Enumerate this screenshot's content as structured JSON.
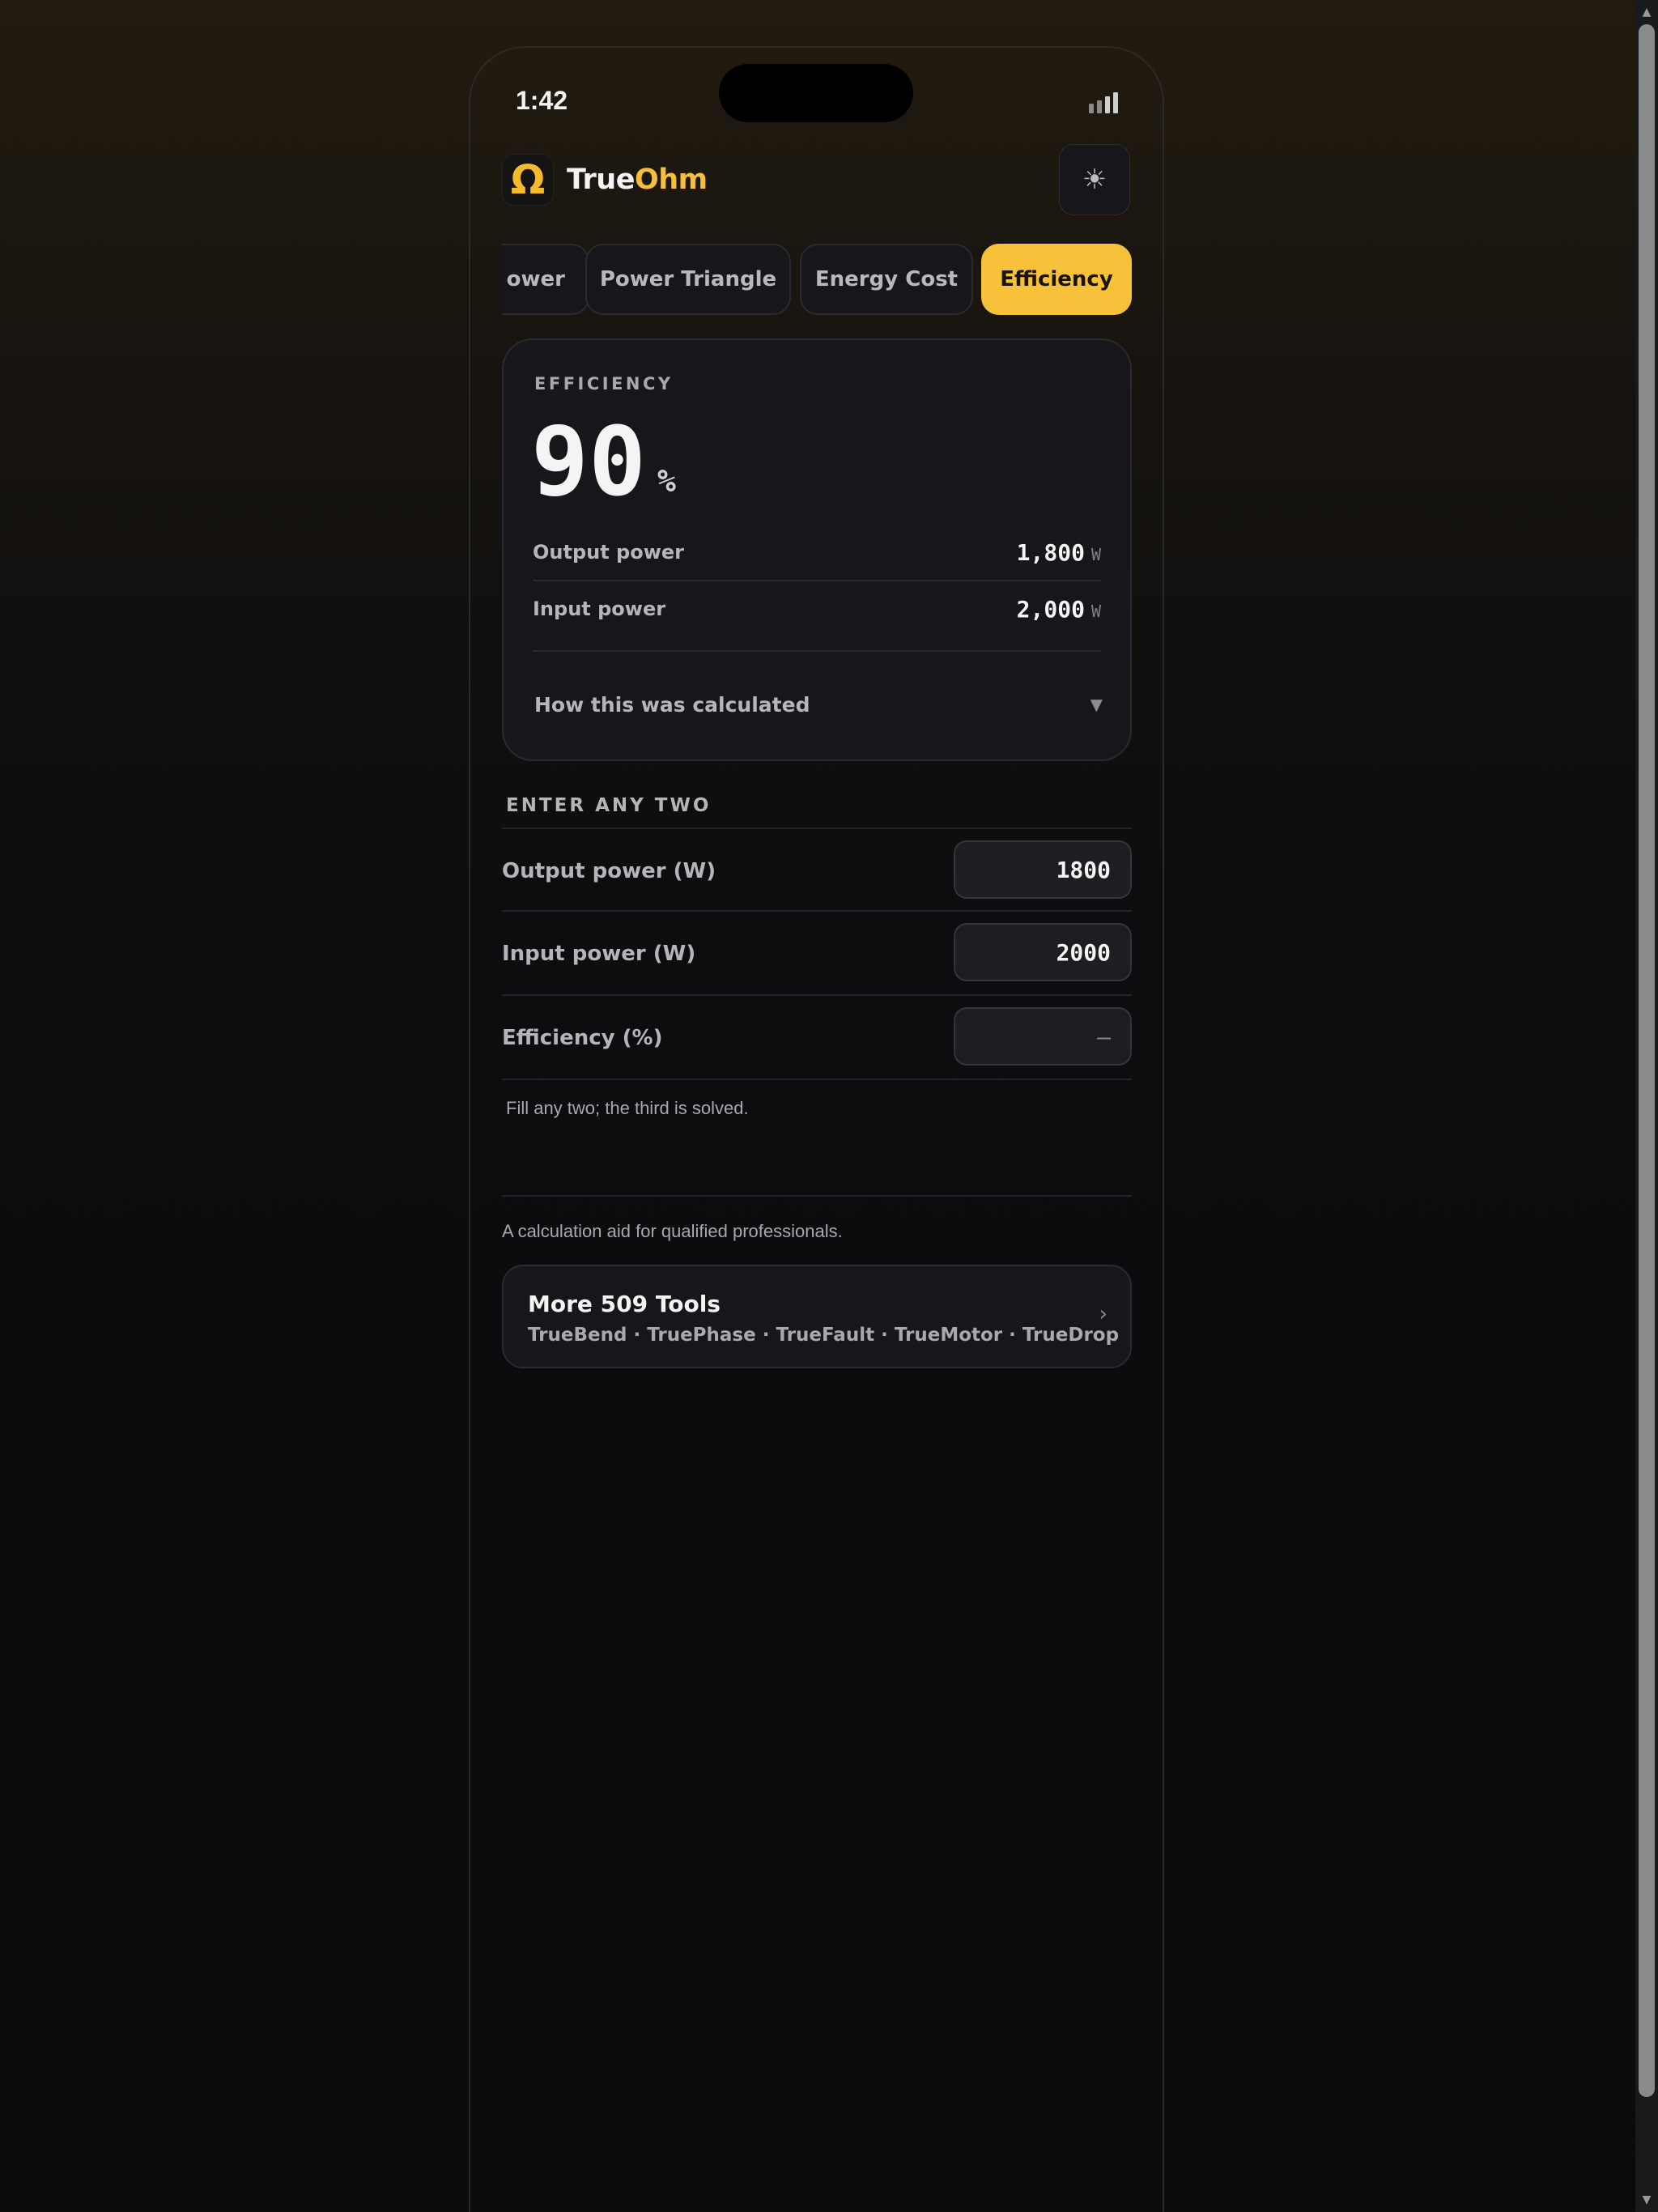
{
  "status": {
    "time": "1:42"
  },
  "brand": {
    "logo_glyph": "Ω",
    "name_part1": "True",
    "name_part2": "Ohm",
    "accent": "#f6be39"
  },
  "theme_toggle": {
    "icon": "sun-icon",
    "glyph": "☀"
  },
  "tabs": [
    {
      "label": "Power",
      "visible_text": "ower",
      "active": false
    },
    {
      "label": "Power Triangle",
      "active": false
    },
    {
      "label": "Energy Cost",
      "active": false
    },
    {
      "label": "Efficiency",
      "active": true
    }
  ],
  "result": {
    "label": "EFFICIENCY",
    "value": "90",
    "unit": "%",
    "rows": [
      {
        "label": "Output power",
        "value": "1,800",
        "unit": "W"
      },
      {
        "label": "Input power",
        "value": "2,000",
        "unit": "W"
      }
    ],
    "how_label": "How this was calculated",
    "how_chevron": "▼"
  },
  "inputs": {
    "section_title": "ENTER ANY TWO",
    "fields": [
      {
        "label": "Output power (W)",
        "value": "1800",
        "placeholder": ""
      },
      {
        "label": "Input power (W)",
        "value": "2000",
        "placeholder": ""
      },
      {
        "label": "Efficiency (%)",
        "value": "",
        "placeholder": "–"
      }
    ],
    "hint": "Fill any two; the third is solved."
  },
  "footer": {
    "disclaimer": "A calculation aid for qualified professionals.",
    "more_title": "More 509 Tools",
    "more_subtitle": "TrueBend · TruePhase · TrueFault · TrueMotor · TrueDrop",
    "more_chevron": "›"
  }
}
